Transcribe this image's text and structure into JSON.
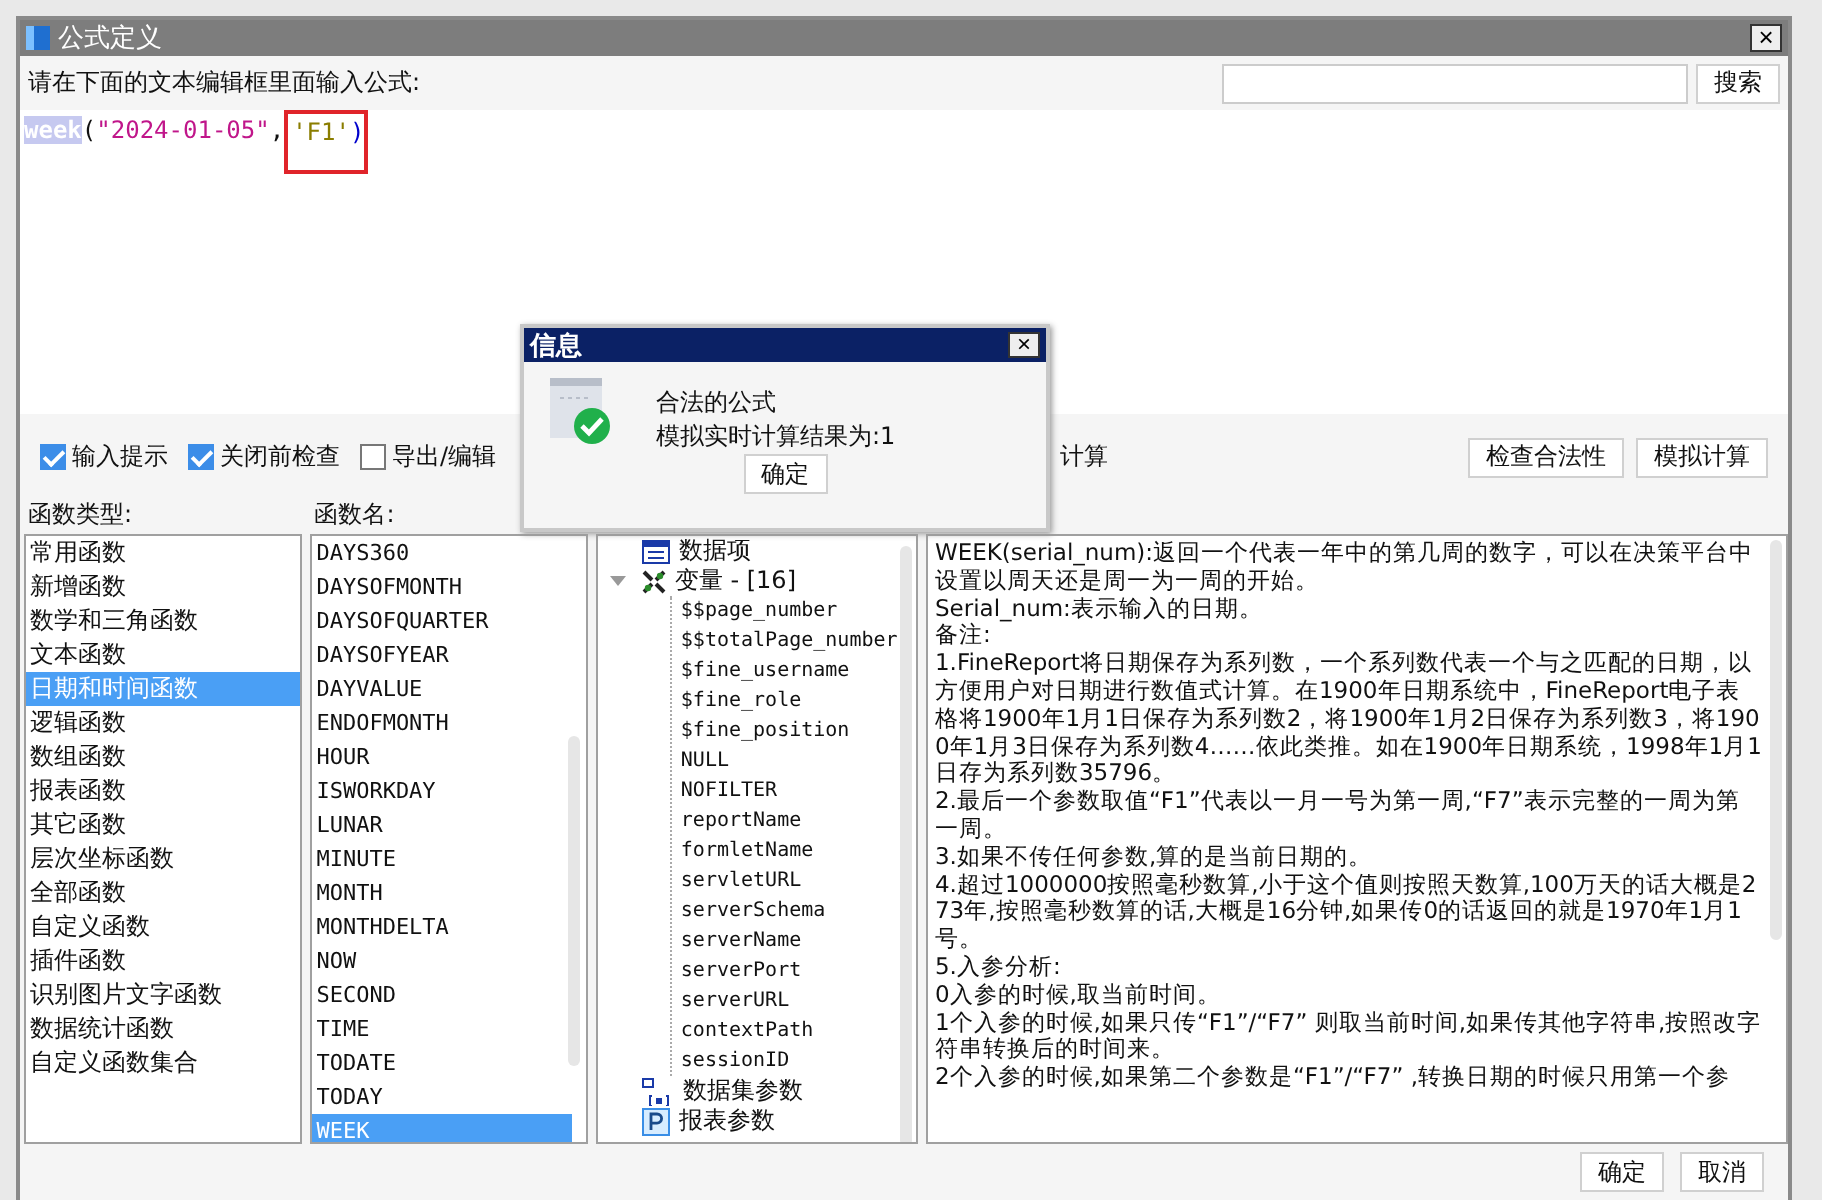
{
  "window": {
    "title": "公式定义",
    "close": "×"
  },
  "prompt": "请在下面的文本编辑框里面输入公式:",
  "search": {
    "button": "搜索"
  },
  "editor": {
    "tokens": [
      {
        "kind": "function",
        "text": "week",
        "selected": true,
        "boxed": false
      },
      {
        "kind": "punct",
        "text": "(",
        "selected": false,
        "boxed": false
      },
      {
        "kind": "string",
        "text": "\"2024-01-05\"",
        "selected": false,
        "boxed": false
      },
      {
        "kind": "punct",
        "text": ",",
        "selected": false,
        "boxed": false
      },
      {
        "kind": "literal",
        "text": "'F1'",
        "selected": false,
        "boxed": true
      },
      {
        "kind": "paren",
        "text": ")",
        "selected": false,
        "boxed": true
      }
    ]
  },
  "options": [
    {
      "label": "输入提示",
      "checked": true
    },
    {
      "label": "关闭前检查",
      "checked": true
    },
    {
      "label": "导出/编辑",
      "checked": false
    }
  ],
  "options_tail": "计算",
  "actions": [
    "检查合法性",
    "模拟计算"
  ],
  "function_types": {
    "label": "函数类型:",
    "items": [
      {
        "text": "常用函数",
        "selected": false
      },
      {
        "text": "新增函数",
        "selected": false
      },
      {
        "text": "数学和三角函数",
        "selected": false
      },
      {
        "text": "文本函数",
        "selected": false
      },
      {
        "text": "日期和时间函数",
        "selected": true
      },
      {
        "text": "逻辑函数",
        "selected": false
      },
      {
        "text": "数组函数",
        "selected": false
      },
      {
        "text": "报表函数",
        "selected": false
      },
      {
        "text": "其它函数",
        "selected": false
      },
      {
        "text": "层次坐标函数",
        "selected": false
      },
      {
        "text": "全部函数",
        "selected": false
      },
      {
        "text": "自定义函数",
        "selected": false
      },
      {
        "text": "插件函数",
        "selected": false
      },
      {
        "text": "识别图片文字函数",
        "selected": false
      },
      {
        "text": "数据统计函数",
        "selected": false
      },
      {
        "text": "自定义函数集合",
        "selected": false
      }
    ]
  },
  "function_names": {
    "label": "函数名:",
    "items": [
      {
        "text": "DAYS360",
        "selected": false
      },
      {
        "text": "DAYSOFMONTH",
        "selected": false
      },
      {
        "text": "DAYSOFQUARTER",
        "selected": false
      },
      {
        "text": "DAYSOFYEAR",
        "selected": false
      },
      {
        "text": "DAYVALUE",
        "selected": false
      },
      {
        "text": "ENDOFMONTH",
        "selected": false
      },
      {
        "text": "HOUR",
        "selected": false
      },
      {
        "text": "ISWORKDAY",
        "selected": false
      },
      {
        "text": "LUNAR",
        "selected": false
      },
      {
        "text": "MINUTE",
        "selected": false
      },
      {
        "text": "MONTH",
        "selected": false
      },
      {
        "text": "MONTHDELTA",
        "selected": false
      },
      {
        "text": "NOW",
        "selected": false
      },
      {
        "text": "SECOND",
        "selected": false
      },
      {
        "text": "TIME",
        "selected": false
      },
      {
        "text": "TODATE",
        "selected": false
      },
      {
        "text": "TODAY",
        "selected": false
      },
      {
        "text": "WEEK",
        "selected": true
      }
    ]
  },
  "tree": [
    {
      "kind": "items",
      "label": "数据项"
    },
    {
      "kind": "variables",
      "label": "变量 - [16]",
      "expanded": true,
      "children": [
        {
          "label": "$$page_number"
        },
        {
          "label": "$$totalPage_number"
        },
        {
          "label": "$fine_username"
        },
        {
          "label": "$fine_role"
        },
        {
          "label": "$fine_position"
        },
        {
          "label": "NULL"
        },
        {
          "label": "NOFILTER"
        },
        {
          "label": "reportName"
        },
        {
          "label": "formletName"
        },
        {
          "label": "servletURL"
        },
        {
          "label": "serverSchema"
        },
        {
          "label": "serverName"
        },
        {
          "label": "serverPort"
        },
        {
          "label": "serverURL"
        },
        {
          "label": "contextPath"
        },
        {
          "label": "sessionID"
        }
      ]
    },
    {
      "kind": "datasets",
      "label": "数据集参数"
    },
    {
      "kind": "parameters",
      "label": "报表参数"
    }
  ],
  "description": [
    "WEEK(serial_num):返回一个代表一年中的第几周的数字，可以在决策平台中设置以周天还是周一为一周的开始。",
    "Serial_num:表示输入的日期。",
    "备注:",
    "1.FineReport将日期保存为系列数，一个系列数代表一个与之匹配的日期，以方便用户对日期进行数值式计算。在1900年日期系统中，FineReport电子表格将1900年1月1日保存为系列数2，将1900年1月2日保存为系列数3，将1900年1月3日保存为系列数4……依此类推。如在1900年日期系统，1998年1月1日存为系列数35796。",
    "2.最后一个参数取值“F1”代表以一月一号为第一周,“F7”表示完整的一周为第一周。",
    "3.如果不传任何参数,算的是当前日期的。",
    "4.超过1000000按照毫秒数算,小于这个值则按照天数算,100万天的话大概是273年,按照毫秒数算的话,大概是16分钟,如果传0的话返回的就是1970年1月1号。",
    "5.入参分析:",
    "0入参的时候,取当前时间。",
    "1个入参的时候,如果只传“F1”/“F7” 则取当前时间,如果传其他字符串,按照改字符串转换后的时间来。",
    "2个入参的时候,如果第二个参数是“F1”/“F7” ,转换日期的时候只用第一个参"
  ],
  "footer": [
    "确定",
    "取消"
  ],
  "message": {
    "title": "信息",
    "close": "×",
    "lines": [
      "合法的公式",
      "模拟实时计算结果为:1"
    ],
    "button": "确定"
  }
}
